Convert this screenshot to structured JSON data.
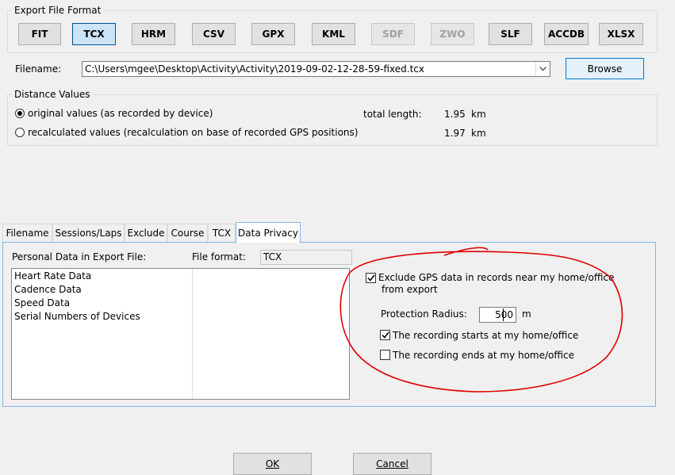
{
  "export_format": {
    "group_label": "Export File Format",
    "buttons": [
      {
        "label": "FIT",
        "state": "normal"
      },
      {
        "label": "TCX",
        "state": "selected"
      },
      {
        "label": "HRM",
        "state": "normal"
      },
      {
        "label": "CSV",
        "state": "normal"
      },
      {
        "label": "GPX",
        "state": "normal"
      },
      {
        "label": "KML",
        "state": "normal"
      },
      {
        "label": "SDF",
        "state": "disabled"
      },
      {
        "label": "ZWO",
        "state": "disabled"
      },
      {
        "label": "SLF",
        "state": "normal"
      },
      {
        "label": "ACCDB",
        "state": "normal"
      },
      {
        "label": "XLSX",
        "state": "normal"
      }
    ]
  },
  "filename": {
    "label": "Filename:",
    "value": "C:\\Users\\mgee\\Desktop\\Activity\\Activity\\2019-09-02-12-28-59-fixed.tcx",
    "browse_label": "Browse"
  },
  "distance": {
    "group_label": "Distance Values",
    "original_label": "original values (as recorded by device)",
    "recalculated_label": "recalculated values (recalculation on base of recorded GPS positions)",
    "total_length_label": "total length:",
    "original_value": "1.95",
    "recalculated_value": "1.97",
    "unit": "km"
  },
  "tabs": [
    {
      "label": "Filename",
      "active": false
    },
    {
      "label": "Sessions/Laps",
      "active": false
    },
    {
      "label": "Exclude",
      "active": false
    },
    {
      "label": "Course",
      "active": false
    },
    {
      "label": "TCX",
      "active": false
    },
    {
      "label": "Data Privacy",
      "active": true
    }
  ],
  "privacy": {
    "personal_data_label": "Personal Data in Export File:",
    "file_format_label": "File format:",
    "file_format_value": "TCX",
    "items": [
      "Heart Rate Data",
      "Cadence Data",
      "Speed Data",
      "Serial Numbers of Devices"
    ],
    "exclude_gps_label_line1": "Exclude GPS data in records near my home/office",
    "exclude_gps_label_line2": "from export",
    "protection_radius_label": "Protection Radius:",
    "protection_radius_value": "500",
    "protection_radius_unit": "m",
    "starts_label": "The recording starts at my home/office",
    "ends_label": "The recording ends at my home/office"
  },
  "dialog": {
    "ok_label": "OK",
    "cancel_label": "Cancel"
  },
  "colors": {
    "annotation": "#e00000",
    "selected_button": "#cce4f7",
    "tab_border": "#7eb4ea"
  }
}
